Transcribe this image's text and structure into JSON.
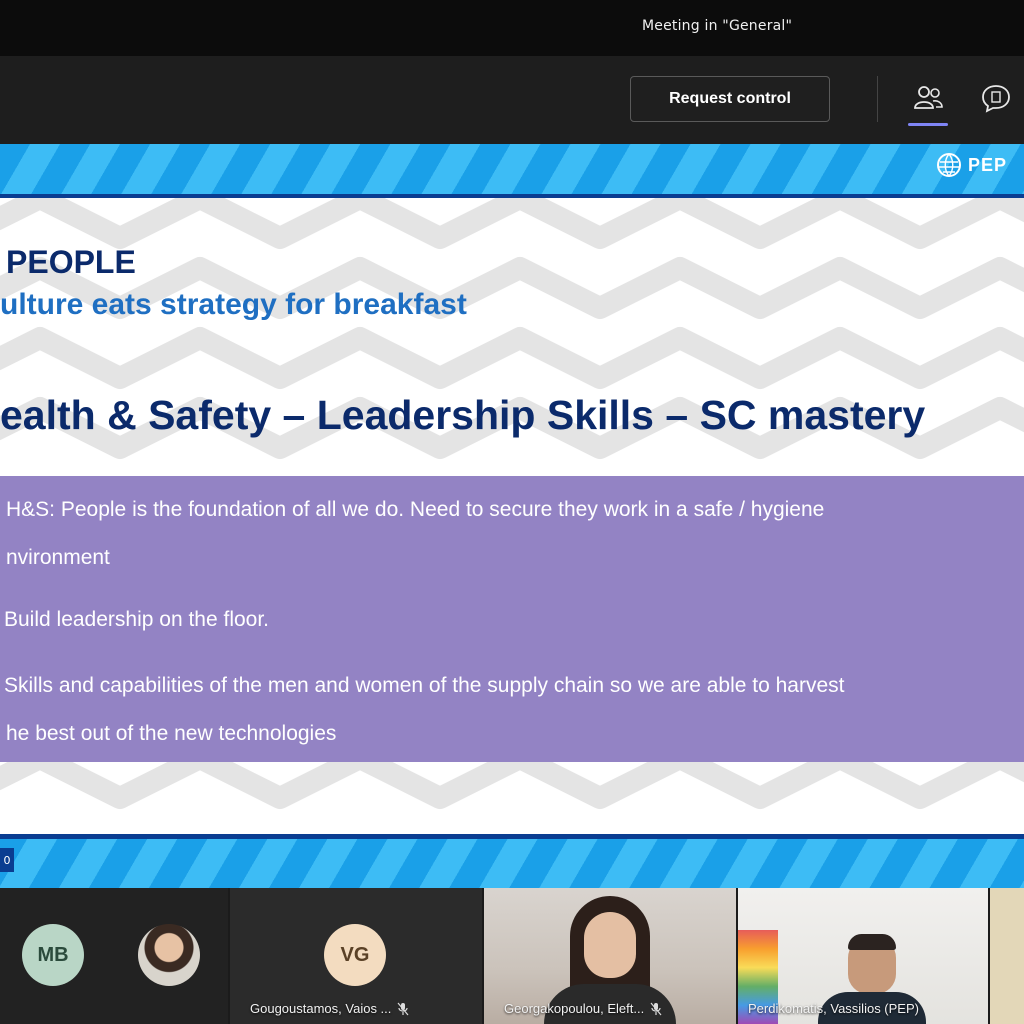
{
  "window": {
    "title": "Meeting in \"General\""
  },
  "toolbar": {
    "request_control_label": "Request control",
    "icons": [
      "people-icon",
      "chat-icon"
    ],
    "accent_color": "#7f85f5"
  },
  "slide": {
    "logo_text": "PEP",
    "heading_people": "PEOPLE",
    "heading_culture": "ulture eats strategy for breakfast",
    "heading_main": "ealth & Safety – Leadership Skills – SC mastery",
    "bullets": [
      "H&S: People is the foundation of all we do. Need to secure they work in a safe / hygiene",
      "nvironment",
      "Build leadership on the floor.",
      "Skills and capabilities of the men and women of the supply chain so we are able to harvest",
      "he best out of the new technologies"
    ],
    "slide_number": "0",
    "colors": {
      "band_blue": "#1aa0e8",
      "dark_navy": "#0b2a6b",
      "accent_blue": "#1f6fc2",
      "purple_box": "#9383c4"
    }
  },
  "participants": {
    "avatar_mb": "MB",
    "avatar_vg": "VG",
    "names": [
      "Gougoustamos, Vaios ...",
      "Georgakopoulou, Eleft...",
      "Perdikomatis, Vassilios (PEP)"
    ]
  }
}
